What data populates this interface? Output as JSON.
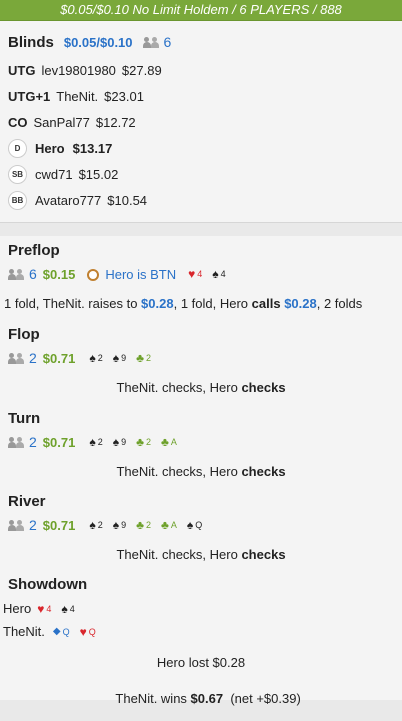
{
  "header": {
    "title": "$0.05/$0.10 No Limit Holdem / 6 PLAYERS / 888"
  },
  "blinds": {
    "title": "Blinds",
    "amount": "$0.05/$0.10",
    "players": "6",
    "seats": [
      {
        "pos": "UTG",
        "name": "lev19801980",
        "stack": "$27.89"
      },
      {
        "pos": "UTG+1",
        "name": "TheNit.",
        "stack": "$23.01"
      },
      {
        "pos": "CO",
        "name": "SanPal77",
        "stack": "$12.72"
      },
      {
        "badge": "D",
        "name": "Hero",
        "stack": "$13.17"
      },
      {
        "badge": "SB",
        "name": "cwd71",
        "stack": "$15.02"
      },
      {
        "badge": "BB",
        "name": "Avataro777",
        "stack": "$10.54"
      }
    ]
  },
  "preflop": {
    "title": "Preflop",
    "players": "6",
    "pot": "$0.15",
    "hero_pos": "Hero is BTN",
    "cards": [
      {
        "suit": "♥",
        "rank": "4",
        "color": "#d9262c"
      },
      {
        "suit": "♠",
        "rank": "4",
        "color": "#111"
      }
    ],
    "action_1": "1 fold, TheNit. raises to ",
    "action_2": "$0.28",
    "action_3": ", 1 fold, Hero ",
    "action_4": "calls",
    "action_5": " ",
    "action_6": "$0.28",
    "action_7": ", 2 folds"
  },
  "flop": {
    "title": "Flop",
    "players": "2",
    "pot": "$0.71",
    "cards": [
      {
        "suit": "♠",
        "rank": "2"
      },
      {
        "suit": "♠",
        "rank": "9"
      },
      {
        "suit": "♣",
        "rank": "2"
      }
    ],
    "action_plain": "TheNit. checks, Hero ",
    "action_bold": "checks"
  },
  "turn": {
    "title": "Turn",
    "players": "2",
    "pot": "$0.71",
    "cards": [
      {
        "suit": "♠",
        "rank": "2"
      },
      {
        "suit": "♠",
        "rank": "9"
      },
      {
        "suit": "♣",
        "rank": "2"
      },
      {
        "suit": "♣",
        "rank": "A"
      }
    ],
    "action_plain": "TheNit. checks, Hero ",
    "action_bold": "checks"
  },
  "river": {
    "title": "River",
    "players": "2",
    "pot": "$0.71",
    "cards": [
      {
        "suit": "♠",
        "rank": "2"
      },
      {
        "suit": "♠",
        "rank": "9"
      },
      {
        "suit": "♣",
        "rank": "2"
      },
      {
        "suit": "♣",
        "rank": "A"
      },
      {
        "suit": "♠",
        "rank": "Q"
      }
    ],
    "action_plain": "TheNit. checks, Hero ",
    "action_bold": "checks"
  },
  "showdown": {
    "title": "Showdown",
    "hero": {
      "name": "Hero",
      "cards": [
        {
          "suit": "♥",
          "rank": "4"
        },
        {
          "suit": "♠",
          "rank": "4"
        }
      ]
    },
    "villain": {
      "name": "TheNit.",
      "cards": [
        {
          "suit": "◆",
          "rank": "Q"
        },
        {
          "suit": "♥",
          "rank": "Q"
        }
      ]
    },
    "result_1": "Hero lost $0.28",
    "result_2a": "TheNit. wins ",
    "result_2b": "$0.67",
    "result_2c": "  (net +$0.39)"
  },
  "colors": {
    "green": "#6ea12b",
    "blue": "#2a72c8",
    "red": "#d9262c",
    "header": "#7aa83a"
  }
}
